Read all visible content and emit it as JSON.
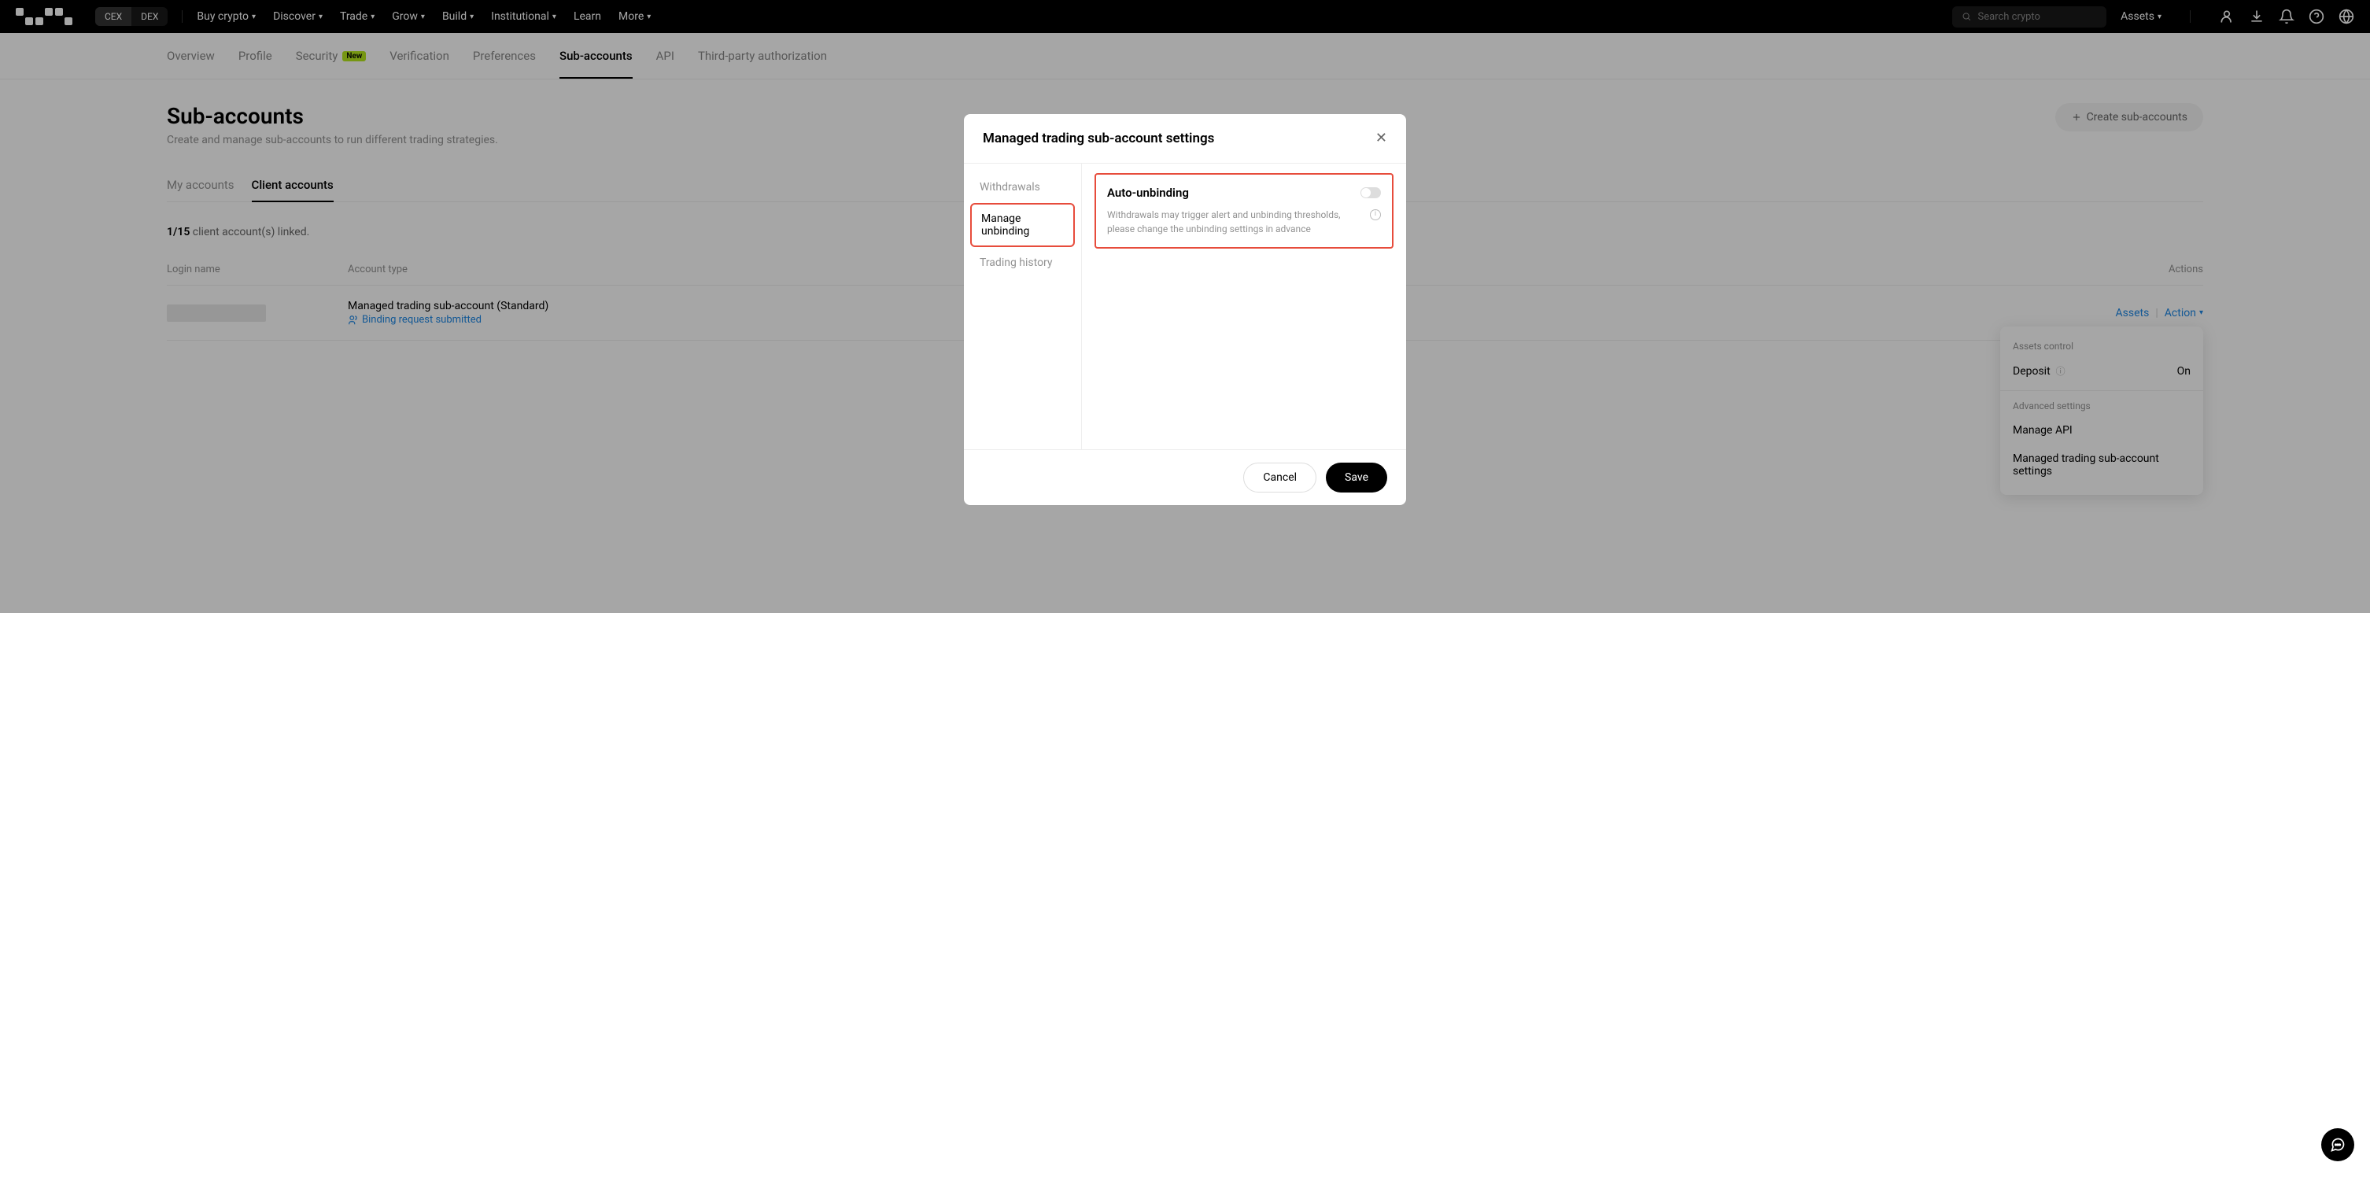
{
  "topbar": {
    "cex": "CEX",
    "dex": "DEX",
    "nav": {
      "buy": "Buy crypto",
      "discover": "Discover",
      "trade": "Trade",
      "grow": "Grow",
      "build": "Build",
      "institutional": "Institutional",
      "learn": "Learn",
      "more": "More"
    },
    "search_placeholder": "Search crypto",
    "assets": "Assets"
  },
  "subnav": {
    "overview": "Overview",
    "profile": "Profile",
    "security": "Security",
    "security_badge": "New",
    "verification": "Verification",
    "preferences": "Preferences",
    "sub_accounts": "Sub-accounts",
    "api": "API",
    "third_party": "Third-party authorization"
  },
  "page": {
    "title": "Sub-accounts",
    "subtitle": "Create and manage sub-accounts to run different trading strategies.",
    "create_btn": "Create sub-accounts"
  },
  "tabs": {
    "my": "My accounts",
    "client": "Client accounts"
  },
  "linked": {
    "count": "1/15",
    "text": " client account(s) linked."
  },
  "table": {
    "headers": {
      "login": "Login name",
      "type": "Account type",
      "actions": "Actions"
    },
    "row": {
      "type": "Managed trading sub-account (Standard)",
      "binding": "Binding request submitted",
      "assets": "Assets",
      "action": "Action"
    }
  },
  "dropdown": {
    "assets_control": "Assets control",
    "deposit": "Deposit",
    "deposit_value": "On",
    "advanced": "Advanced settings",
    "manage_api": "Manage API",
    "managed_settings": "Managed trading sub-account settings"
  },
  "modal": {
    "title": "Managed trading sub-account settings",
    "sidebar": {
      "withdrawals": "Withdrawals",
      "manage_unbinding": "Manage unbinding",
      "trading_history": "Trading history"
    },
    "auto_unbind": {
      "title": "Auto-unbinding",
      "desc": "Withdrawals may trigger alert and unbinding thresholds, please change the unbinding settings in advance"
    },
    "cancel": "Cancel",
    "save": "Save"
  }
}
